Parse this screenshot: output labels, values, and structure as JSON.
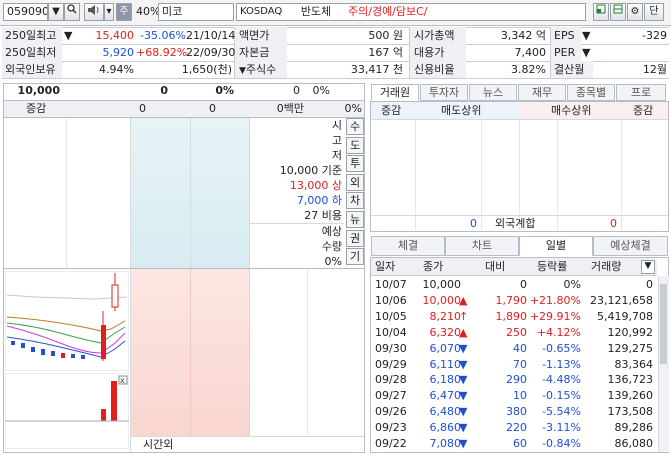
{
  "toolbar": {
    "code": "059090",
    "badge": "주",
    "percent": "40%",
    "name": "미코",
    "market": "KOSDAQ",
    "sector": "반도체",
    "warning": "주의/경예/담보C/",
    "right_label": "단"
  },
  "summary": {
    "high250_label": "250일최고",
    "high250_price": "15,400",
    "high250_rate": "-35.06%",
    "high250_date": "21/10/14",
    "low250_label": "250일최저",
    "low250_price": "5,920",
    "low250_rate": "+68.92%",
    "low250_date": "22/09/30",
    "foreign_label": "외국인보유",
    "foreign_rate": "4.94%",
    "foreign_qty": "1,650(천)",
    "par_label": "액면가",
    "par_value": "500 원",
    "capital_label": "자본금",
    "capital_value": "167 억",
    "shares_label": "주식수",
    "shares_value": "33,417 천",
    "mcap_label": "시가총액",
    "mcap_value": "3,342 억",
    "sub_label": "대용가",
    "sub_value": "7,400",
    "credit_label": "신용비율",
    "credit_value": "3.82%",
    "eps_label": "EPS",
    "eps_value": "-329",
    "per_label": "PER",
    "per_value": "",
    "settle_label": "결산월",
    "settle_value": "12월"
  },
  "quote": {
    "price": "10,000",
    "change": "0",
    "rate": "0%",
    "volume": "0",
    "vol_rate": "0%",
    "label_change": "증감",
    "bid_val": "0",
    "ask_val": "0",
    "amount": "0백만",
    "amount_rate": "0%",
    "info_open": "시",
    "info_high": "고",
    "info_low": "저",
    "base_label": "10,000 기준",
    "upper_label": "13,000 상",
    "lower_label": "7,000 하",
    "ratio_label": "27 비용",
    "expect_label": "예상",
    "expect_qty_label": "수량",
    "expect_rate": "0%",
    "afterhours": "시간외"
  },
  "side_buttons": [
    "수",
    "도",
    "투",
    "외",
    "차",
    "뉴",
    "권",
    "기"
  ],
  "broker": {
    "tabs": [
      "거래원",
      "투자자",
      "뉴스",
      "재무",
      "종목별",
      "프로"
    ],
    "headers": [
      "증감",
      "매도상위",
      "매수상위",
      "증감"
    ],
    "foreign_label": "외국계합",
    "foreign_sell": "0",
    "foreign_buy": "0"
  },
  "daily_tabs": [
    "체결",
    "차트",
    "일별",
    "예상체결"
  ],
  "daily_headers": [
    "일자",
    "종가",
    "대비",
    "등락률",
    "거래량"
  ],
  "daily_rows": [
    {
      "date": "10/07",
      "close": "10,000",
      "arrow": "",
      "diff": "0",
      "rate": "0%",
      "vol": "0",
      "color": "black"
    },
    {
      "date": "10/06",
      "close": "10,000",
      "arrow": "▲",
      "diff": "1,790",
      "rate": "+21.80%",
      "vol": "23,121,658",
      "color": "red"
    },
    {
      "date": "10/05",
      "close": "8,210",
      "arrow": "↑",
      "diff": "1,890",
      "rate": "+29.91%",
      "vol": "5,419,708",
      "color": "red"
    },
    {
      "date": "10/04",
      "close": "6,320",
      "arrow": "▲",
      "diff": "250",
      "rate": "+4.12%",
      "vol": "120,992",
      "color": "red"
    },
    {
      "date": "09/30",
      "close": "6,070",
      "arrow": "▼",
      "diff": "40",
      "rate": "-0.65%",
      "vol": "129,275",
      "color": "blue"
    },
    {
      "date": "09/29",
      "close": "6,110",
      "arrow": "▼",
      "diff": "70",
      "rate": "-1.13%",
      "vol": "83,364",
      "color": "blue"
    },
    {
      "date": "09/28",
      "close": "6,180",
      "arrow": "▼",
      "diff": "290",
      "rate": "-4.48%",
      "vol": "136,723",
      "color": "blue"
    },
    {
      "date": "09/27",
      "close": "6,470",
      "arrow": "▼",
      "diff": "10",
      "rate": "-0.15%",
      "vol": "139,260",
      "color": "blue"
    },
    {
      "date": "09/26",
      "close": "6,480",
      "arrow": "▼",
      "diff": "380",
      "rate": "-5.54%",
      "vol": "173,508",
      "color": "blue"
    },
    {
      "date": "09/23",
      "close": "6,860",
      "arrow": "▼",
      "diff": "220",
      "rate": "-3.11%",
      "vol": "89,286",
      "color": "blue"
    },
    {
      "date": "09/22",
      "close": "7,080",
      "arrow": "▼",
      "diff": "60",
      "rate": "-0.84%",
      "vol": "86,080",
      "color": "blue"
    }
  ],
  "colors": {
    "up": "#e0201f",
    "down": "#1d50d6",
    "label_bg": "#eef0f4"
  }
}
